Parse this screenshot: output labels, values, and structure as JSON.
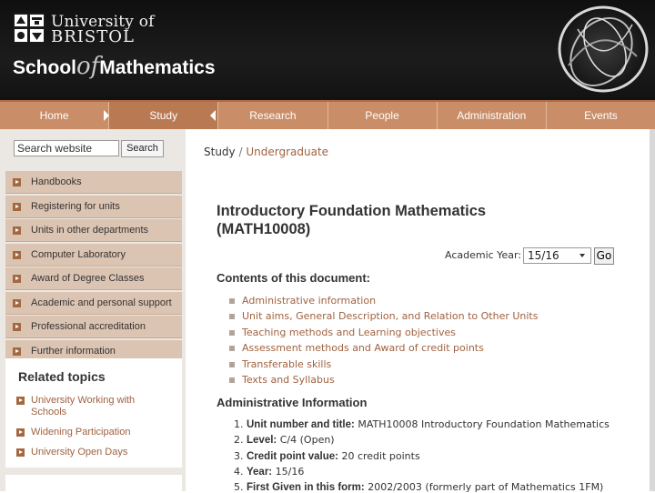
{
  "header": {
    "university_line1": "University of",
    "university_line2": "BRISTOL",
    "school_prefix": "School",
    "school_of": "of",
    "school_suffix": "Mathematics"
  },
  "nav": {
    "items": [
      {
        "label": "Home"
      },
      {
        "label": "Study"
      },
      {
        "label": "Research"
      },
      {
        "label": "People"
      },
      {
        "label": "Administration"
      },
      {
        "label": "Events"
      }
    ],
    "active": "Study"
  },
  "sidebar": {
    "search_placeholder": "Search website",
    "search_button": "Search",
    "items": [
      {
        "label": "Handbooks"
      },
      {
        "label": "Registering for units"
      },
      {
        "label": "Units in other departments"
      },
      {
        "label": "Computer Laboratory"
      },
      {
        "label": "Award of Degree Classes"
      },
      {
        "label": "Academic and personal support"
      },
      {
        "label": "Professional accreditation"
      },
      {
        "label": "Further information"
      }
    ],
    "related_title": "Related topics",
    "related": [
      {
        "label": "University Working with Schools"
      },
      {
        "label": "Widening Participation"
      },
      {
        "label": "University Open Days"
      }
    ]
  },
  "breadcrumb": {
    "root": "Study",
    "separator": "/",
    "current": "Undergraduate"
  },
  "main": {
    "title_line1": "Introductory Foundation Mathematics",
    "title_line2": "(MATH10008)",
    "year_label": "Academic Year:",
    "year_value": "15/16",
    "go_label": "Go",
    "contents_heading": "Contents of this document:",
    "toc": [
      {
        "label": "Administrative information"
      },
      {
        "label": "Unit aims,   General Description, and Relation to Other Units"
      },
      {
        "label": "Teaching methods and Learning objectives"
      },
      {
        "label": "Assessment methods and Award of credit points"
      },
      {
        "label": "Transferable skills"
      },
      {
        "label": "Texts and Syllabus"
      }
    ],
    "admin_heading": "Administrative Information",
    "admin": [
      {
        "num": "1.",
        "key": "Unit number and title:",
        "value": "MATH10008 Introductory Foundation Mathematics"
      },
      {
        "num": "2.",
        "key": "Level:",
        "value": "C/4 (Open)"
      },
      {
        "num": "3.",
        "key": "Credit point value:",
        "value": "20 credit points"
      },
      {
        "num": "4.",
        "key": "Year:",
        "value": "15/16"
      },
      {
        "num": "5.",
        "key": "First Given in this form:",
        "value": "2002/2003 (formerly part of Mathematics 1FM)"
      }
    ]
  },
  "colors": {
    "nav_bg": "#c98d68",
    "nav_active": "#b97a53",
    "sidebar_item_bg": "#dcc4b3",
    "link": "#a06240",
    "header_bg": "#1a1a1a"
  }
}
